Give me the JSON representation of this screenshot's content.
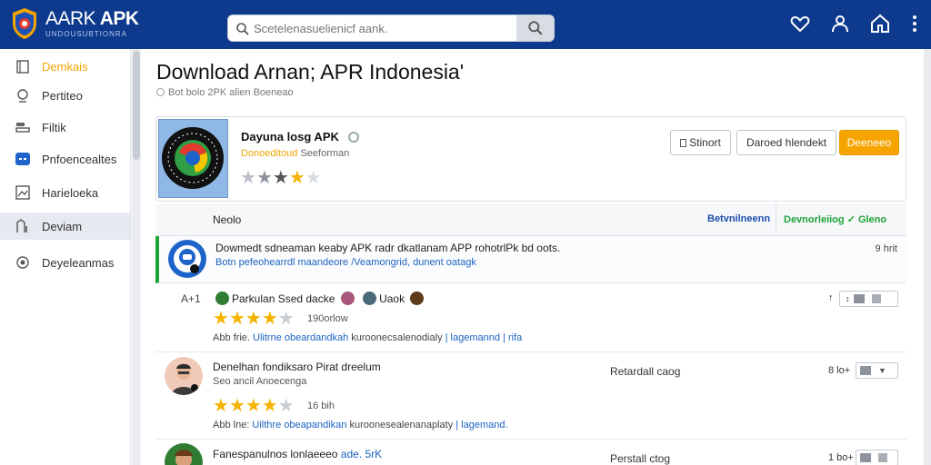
{
  "header": {
    "logo_main": "AARK",
    "logo_accent": "APK",
    "logo_sub": "UNDOUSUBTIONRA",
    "search": {
      "placeholder": "Scetelenasuelienicf aank."
    },
    "icons": [
      "heart-icon",
      "user-icon",
      "home-icon",
      "more-vertical-icon"
    ]
  },
  "sidebar": {
    "items": [
      {
        "label": "Demkais",
        "icon": "clipboard-icon",
        "active": true
      },
      {
        "label": "Pertiteo",
        "icon": "person-icon"
      },
      {
        "label": "Filtik",
        "icon": "filter-icon"
      },
      {
        "label": "Pnfoencealtes",
        "icon": "link-icon"
      },
      {
        "label": "Harieloeka",
        "icon": "image-icon"
      },
      {
        "label": "Deviam",
        "icon": "chart-icon",
        "selected": true
      },
      {
        "label": "Deyeleanmas",
        "icon": "gear-icon"
      }
    ]
  },
  "main": {
    "title": "Download Arnan; APR Indonesia'",
    "breadcrumb": "Bot bolo  2PK alien Boeneao",
    "app": {
      "name": "Dayuna losg APK",
      "sub_highlight": "Donoeditoud",
      "sub_rest": " Seeforman",
      "rating": 3.5,
      "buttons": {
        "share": "Stinort",
        "secondary": "Daroed hlendekt",
        "primary": "Deeneeo"
      }
    },
    "tabs": {
      "col1": "Neolo",
      "col2": "Betvnilneenn",
      "col3": "Devnorleiiog",
      "col3_b": "Gleno"
    },
    "notice": {
      "line1": "Dowmedt sdneaman keaby APK radr dkatlanam APP rohotrlPk bd oots.",
      "line2": "Botn pefeohearrdl maandeore /Veamongrid, dunent oatagk",
      "time": "9 hrit"
    },
    "reviews": [
      {
        "num": "A+1",
        "author": "Parkulan Ssed dacke",
        "extra": "Uaok",
        "rating": 4,
        "count": "190orlow",
        "line_prefix": "Abb frie. ",
        "line_blue": "Ulitrne obeardandkah",
        "line_mid": " kuroonecsalenodialy ",
        "line_blue2": "| lagemannd | ",
        "line_end": "rifa",
        "right": "↑"
      },
      {
        "author": "Denelhan fondiksaro Pirat dreelum",
        "sub": "Seo ancil Anoecenga",
        "rating": 4,
        "count": "16 bih",
        "line_prefix": "Abb lne: ",
        "line_blue": "Uilthre obeapandikan",
        "line_mid": " kuroonesealenanaplaty ",
        "line_blue2": "| lagemand.",
        "middle": "Retardall caog",
        "right": "8 lo+"
      },
      {
        "author": "Fanespanulnos lonlaeeeo",
        "author_blue": "ade. 5rK",
        "middle": "Perstall ctog",
        "right": "1 bo+"
      }
    ]
  },
  "colors": {
    "header": "#0d3a8c",
    "accent": "#f5a400",
    "link": "#1b62c2",
    "success": "#1ea336"
  }
}
